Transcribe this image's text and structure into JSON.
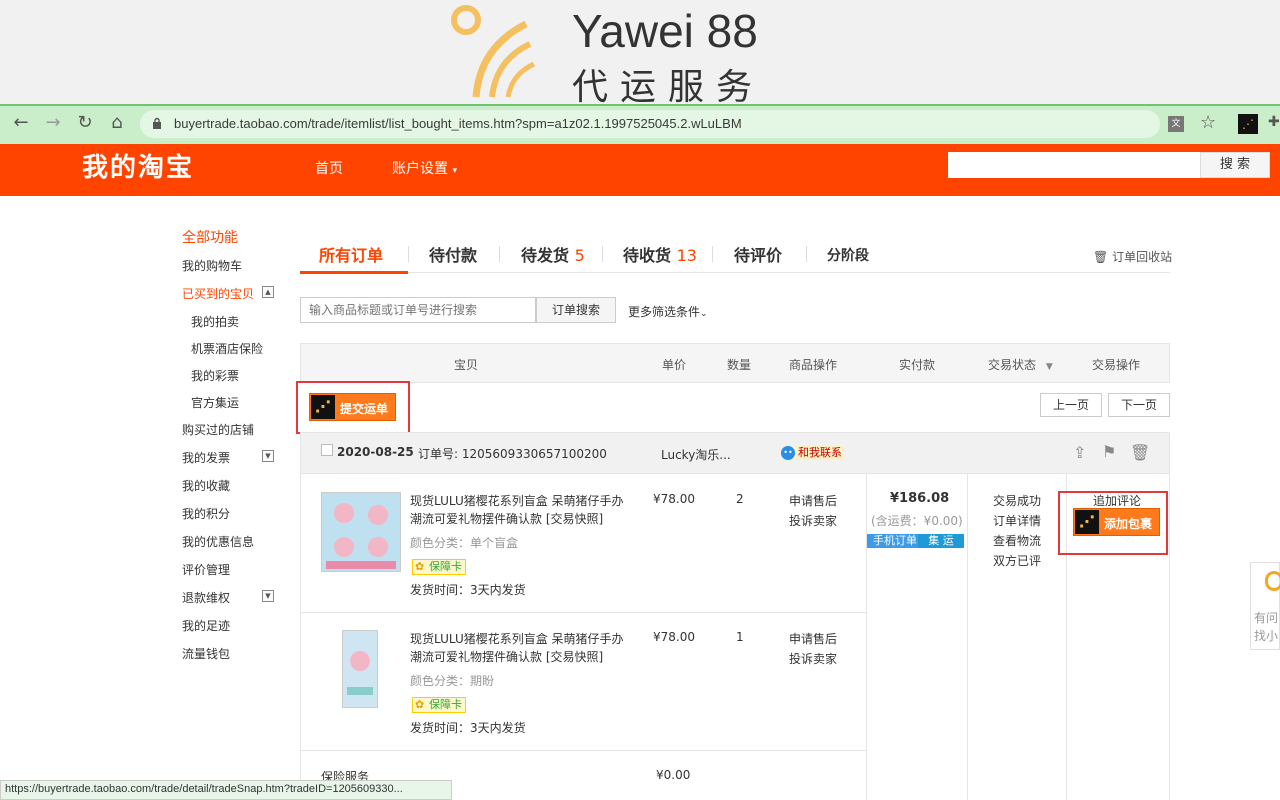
{
  "banner": {
    "brand_en": "Yawei 88",
    "brand_cn": "代运服务"
  },
  "browser": {
    "url": "buyertrade.taobao.com/trade/itemlist/list_bought_items.htm?spm=a1z02.1.1997525045.2.wLuLBM"
  },
  "header": {
    "title": "我的淘宝",
    "nav_home": "首页",
    "nav_account": "账户设置",
    "search_button": "搜 索"
  },
  "sidebar": {
    "all": "全部功能",
    "cart": "我的购物车",
    "bought": "已买到的宝贝",
    "auction": "我的拍卖",
    "flight": "机票酒店保险",
    "lottery": "我的彩票",
    "consolidate": "官方集运",
    "shops": "购买过的店铺",
    "invoice": "我的发票",
    "favorites": "我的收藏",
    "points": "我的积分",
    "coupons": "我的优惠信息",
    "reviews": "评价管理",
    "refund": "退款维权",
    "footprint": "我的足迹",
    "wallet": "流量钱包"
  },
  "tabs": {
    "all": "所有订单",
    "unpaid": "待付款",
    "unshipped": "待发货",
    "unshipped_count": "5",
    "unreceived": "待收货",
    "unreceived_count": "13",
    "unrated": "待评价",
    "staged": "分阶段",
    "recycle": "订单回收站"
  },
  "search": {
    "placeholder": "输入商品标题或订单号进行搜索",
    "button": "订单搜索",
    "more": "更多筛选条件"
  },
  "table": {
    "headers": [
      "宝贝",
      "单价",
      "数量",
      "商品操作",
      "实付款",
      "交易状态",
      "交易操作"
    ]
  },
  "actions": {
    "submit_waybill": "提交运单",
    "prev": "上一页",
    "next": "下一页",
    "add_package": "添加包裹"
  },
  "order": {
    "date": "2020-08-25",
    "order_no_label": "订单号:",
    "order_no": "1205609330657100200",
    "seller": "Lucky淘乐...",
    "contact": "和我联系",
    "total": "¥186.08",
    "shipping": "(含运费：¥0.00)",
    "tag_mobile": "手机订单",
    "tag_consolidate": "集 运",
    "status": [
      "交易成功",
      "订单详情",
      "查看物流",
      "双方已评"
    ],
    "add_review": "追加评论",
    "items": [
      {
        "title": "现货LULU猪樱花系列盲盒 呆萌猪仔手办潮流可爱礼物摆件确认款 [交易快照]",
        "variant": "颜色分类：单个盲盒",
        "guarantee": "保障卡",
        "ship": "发货时间：3天内发货",
        "price": "¥78.00",
        "qty": "2",
        "ops": [
          "申请售后",
          "投诉卖家"
        ]
      },
      {
        "title": "现货LULU猪樱花系列盲盒 呆萌猪仔手办潮流可爱礼物摆件确认款 [交易快照]",
        "variant": "颜色分类：期盼",
        "guarantee": "保障卡",
        "ship": "发货时间：3天内发货",
        "price": "¥78.00",
        "qty": "1",
        "ops": [
          "申请售后",
          "投诉卖家"
        ]
      }
    ],
    "insurance_label": "保险服务",
    "insurance_price": "¥0.00"
  },
  "helper": {
    "line1": "有问",
    "line2": "找小"
  },
  "statusbar": {
    "url": "https://buyertrade.taobao.com/trade/detail/tradeSnap.htm?tradeID=1205609330..."
  },
  "colors": {
    "brand": "#ff4400",
    "browser_bar": "#c9eec9",
    "orange_button": "#ff7a1a",
    "highlight_box": "#e4393c"
  }
}
